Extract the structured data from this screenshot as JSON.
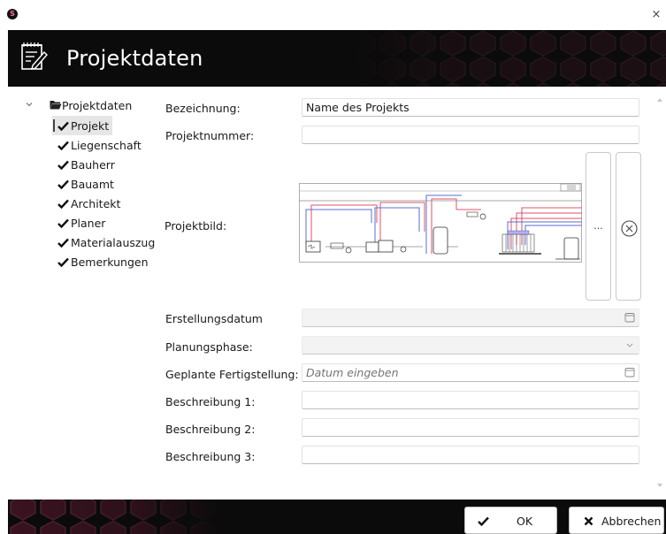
{
  "window": {
    "app_icon_glyph": "S",
    "close_glyph": "×"
  },
  "header": {
    "title": "Projektdaten"
  },
  "tree": {
    "root_label": "Projektdaten",
    "items": [
      {
        "label": "Projekt",
        "selected": true
      },
      {
        "label": "Liegenschaft"
      },
      {
        "label": "Bauherr"
      },
      {
        "label": "Bauamt"
      },
      {
        "label": "Architekt"
      },
      {
        "label": "Planer"
      },
      {
        "label": "Materialauszug"
      },
      {
        "label": "Bemerkungen"
      }
    ]
  },
  "form": {
    "bezeichnung_label": "Bezeichnung:",
    "bezeichnung_value": "Name des Projekts",
    "projektnummer_label": "Projektnummer:",
    "projektnummer_value": "",
    "projektbild_label": "Projektbild:",
    "browse_label": "...",
    "erstellungsdatum_label": "Erstellungsdatum",
    "erstellungsdatum_value": "",
    "planungsphase_label": "Planungsphase:",
    "planungsphase_value": "",
    "fertigstellung_label": "Geplante Fertigstellung:",
    "fertigstellung_placeholder": "Datum eingeben",
    "beschreibung1_label": "Beschreibung 1:",
    "beschreibung1_value": "",
    "beschreibung2_label": "Beschreibung 2:",
    "beschreibung2_value": "",
    "beschreibung3_label": "Beschreibung 3:",
    "beschreibung3_value": ""
  },
  "footer": {
    "ok_label": "OK",
    "cancel_label": "Abbrechen"
  },
  "colors": {
    "banner": "#0b0b0b",
    "hex_accent": "#3a1320",
    "pipe_red": "#e0506a",
    "pipe_blue": "#5a6fd0"
  },
  "icons": {
    "app": "app-logo-icon",
    "header": "edit-document-icon",
    "folder": "folder-open-icon",
    "check": "check-icon",
    "calendar": "calendar-icon",
    "dropdown": "chevron-down-icon",
    "remove": "remove-circle-icon",
    "ok": "check-icon",
    "cancel": "x-icon"
  }
}
